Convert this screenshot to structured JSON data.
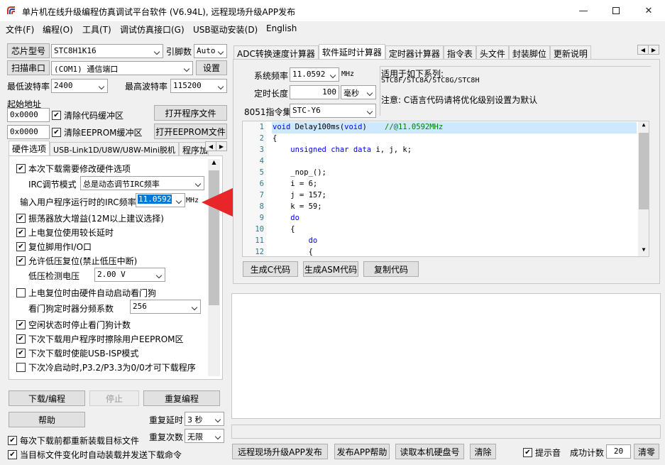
{
  "title": "单片机在线升级编程仿真调试平台软件 (V6.94L), 远程现场升级APP发布",
  "menu": [
    "文件(F)",
    "编程(O)",
    "工具(T)",
    "调试仿真接口(G)",
    "USB驱动安装(D)",
    "English"
  ],
  "left": {
    "chip_label": "芯片型号",
    "chip_value": "STC8H1K16",
    "pins_label": "引脚数",
    "pins_value": "Auto",
    "scan_label": "扫描串口",
    "port_value": "(COM1) 通信端口",
    "settings_label": "设置",
    "min_baud_label": "最低波特率",
    "min_baud_value": "2400",
    "max_baud_label": "最高波特率",
    "max_baud_value": "115200",
    "start_addr_label": "起始地址",
    "addr1": "0x0000",
    "clear_code": "清除代码缓冲区",
    "open_prog": "打开程序文件",
    "addr2": "0x0000",
    "clear_eeprom": "清除EEPROM缓冲区",
    "open_eeprom": "打开EEPROM文件",
    "tabs": [
      "硬件选项",
      "USB-Link1D/U8W/U8W-Mini脱机",
      "程序加"
    ],
    "opts": {
      "modify_hw": "本次下载需要修改硬件选项",
      "irc_mode_label": "IRC调节模式",
      "irc_mode_value": "总是动态调节IRC频率",
      "irc_freq_label": "输入用户程序运行时的IRC频率",
      "irc_freq_value": "11.0592",
      "irc_freq_unit": "MHz",
      "osc_gain": "振荡器放大增益(12M以上建议选择)",
      "power_delay": "上电复位使用较长延时",
      "reset_io": "复位脚用作I/O口",
      "lvd_reset": "允许低压复位(禁止低压中断)",
      "lvd_label": "低压检测电压",
      "lvd_value": "2.00 V",
      "wdt_start": "上电复位时由硬件自动启动看门狗",
      "wdt_div_label": "看门狗定时器分频系数",
      "wdt_div_value": "256",
      "idle_wdt": "空闲状态时停止看门狗计数",
      "erase_eeprom": "下次下载用户程序时擦除用户EEPROM区",
      "usb_isp": "下次下载时使能USB-ISP模式",
      "p32": "下次冷启动时,P3.2/P3.3为0/0才可下载程序"
    },
    "download": "下载/编程",
    "stop": "停止",
    "reprogram": "重复编程",
    "help": "帮助",
    "repeat_delay_label": "重复延时",
    "repeat_delay_value": "3 秒",
    "repeat_count_label": "重复次数",
    "repeat_count_value": "无限",
    "reload_each": "每次下载前都重新装载目标文件",
    "auto_send": "当目标文件变化时自动装载并发送下载命令"
  },
  "right": {
    "tabs": [
      "ADC转换速度计算器",
      "软件延时计算器",
      "定时器计算器",
      "指令表",
      "头文件",
      "封装脚位",
      "更新说明"
    ],
    "sysfreq_label": "系统频率",
    "sysfreq_value": "11.0592",
    "sysfreq_unit": "MHz",
    "len_label": "定时长度",
    "len_value": "100",
    "len_unit": "毫秒",
    "isa_label": "8051指令集",
    "isa_value": "STC-Y6",
    "applies_title": "适用于如下系列:",
    "applies_list": "STC8F/STC8A/STC8G/STC8H",
    "note": "注意: C语言代码请将优化级别设置为默认",
    "code": [
      {
        "n": "1",
        "t": "void Delay100ms(void)",
        "c": "//@11.0592MHz"
      },
      {
        "n": "2",
        "t": "{",
        "c": ""
      },
      {
        "n": "3",
        "t": "    unsigned char data i, j, k;",
        "c": ""
      },
      {
        "n": "4",
        "t": "",
        "c": ""
      },
      {
        "n": "5",
        "t": "    _nop_();",
        "c": ""
      },
      {
        "n": "6",
        "t": "    i = 6;",
        "c": ""
      },
      {
        "n": "7",
        "t": "    j = 157;",
        "c": ""
      },
      {
        "n": "8",
        "t": "    k = 59;",
        "c": ""
      },
      {
        "n": "9",
        "t": "    do",
        "c": ""
      },
      {
        "n": "10",
        "t": "    {",
        "c": ""
      },
      {
        "n": "11",
        "t": "        do",
        "c": ""
      },
      {
        "n": "12",
        "t": "        {",
        "c": ""
      }
    ],
    "gen_c": "生成C代码",
    "gen_asm": "生成ASM代码",
    "copy": "复制代码",
    "remote": "远程现场升级APP发布",
    "publish_help": "发布APP帮助",
    "read_disk": "读取本机硬盘号",
    "clear": "清除",
    "beep": "提示音",
    "success_label": "成功计数",
    "success_value": "20",
    "reset": "清零"
  },
  "colors": {
    "accent": "#0078d7",
    "arrow": "#e8262a",
    "code_hl": "#cde8ff"
  }
}
